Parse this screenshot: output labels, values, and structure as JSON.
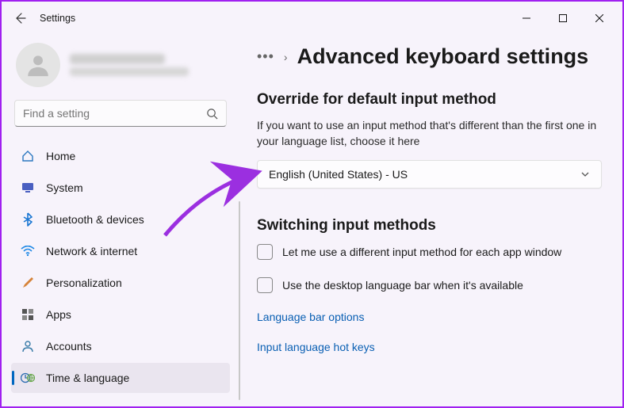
{
  "window": {
    "title": "Settings",
    "controls": {
      "min": "—",
      "max": "▢",
      "close": "✕"
    }
  },
  "search": {
    "placeholder": "Find a setting"
  },
  "sidebar": {
    "items": [
      {
        "label": "Home"
      },
      {
        "label": "System"
      },
      {
        "label": "Bluetooth & devices"
      },
      {
        "label": "Network & internet"
      },
      {
        "label": "Personalization"
      },
      {
        "label": "Apps"
      },
      {
        "label": "Accounts"
      },
      {
        "label": "Time & language"
      }
    ]
  },
  "page": {
    "title": "Advanced keyboard settings",
    "sections": {
      "override": {
        "heading": "Override for default input method",
        "description": "If you want to use an input method that's different than the first one in your language list, choose it here",
        "dropdown_value": "English (United States) - US"
      },
      "switching": {
        "heading": "Switching input methods",
        "checkbox1": "Let me use a different input method for each app window",
        "checkbox2": "Use the desktop language bar when it's available",
        "link1": "Language bar options",
        "link2": "Input language hot keys"
      }
    }
  }
}
